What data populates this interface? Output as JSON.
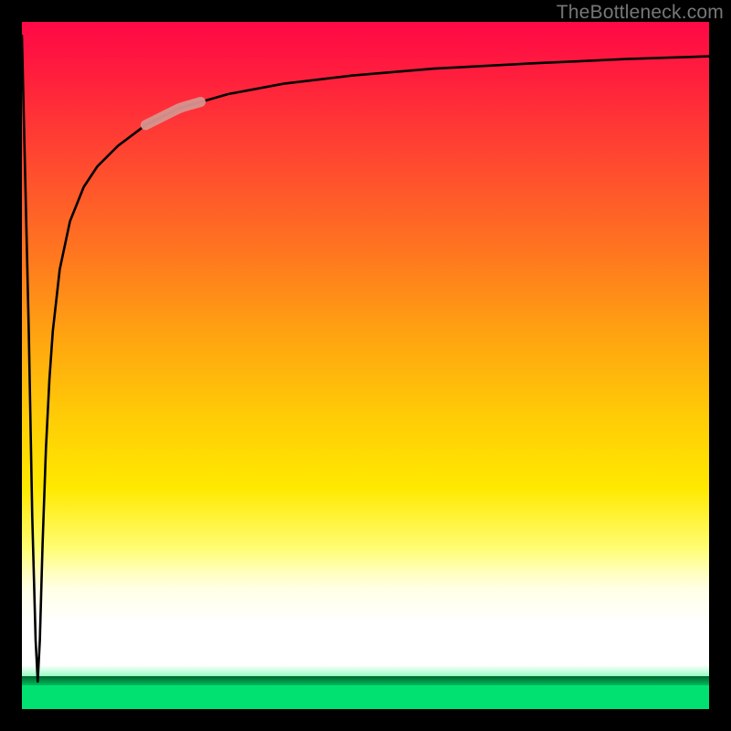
{
  "attribution": "TheBottleneck.com",
  "colors": {
    "frame": "#000000",
    "curve": "#000000",
    "highlight": "#d8948e",
    "gradient_top": "#ff0846",
    "gradient_bottom_green": "#00e172"
  },
  "chart_data": {
    "type": "line",
    "title": "",
    "xlabel": "",
    "ylabel": "",
    "xlim": [
      0,
      100
    ],
    "ylim": [
      0,
      100
    ],
    "grid": false,
    "legend": false,
    "annotations": [],
    "series": [
      {
        "name": "bottleneck-curve",
        "x": [
          0,
          1,
          1.5,
          2.0,
          2.3,
          2.6,
          3.0,
          3.5,
          4.0,
          4.5,
          5.5,
          7,
          9,
          11,
          14,
          18,
          23,
          30,
          38,
          48,
          60,
          75,
          88,
          100
        ],
        "y": [
          98,
          55,
          28,
          10,
          4,
          10,
          24,
          38,
          48,
          55,
          64,
          71,
          76,
          79,
          82,
          85,
          87.5,
          89.5,
          91,
          92.2,
          93.2,
          94,
          94.6,
          95
        ]
      }
    ],
    "highlight_segment": {
      "series": "bottleneck-curve",
      "x_start": 18,
      "x_end": 26,
      "y_start": 80,
      "y_end": 86
    },
    "background_gradient": {
      "orientation": "vertical",
      "stops": [
        {
          "pos": 0.0,
          "color": "#ff0846"
        },
        {
          "pos": 0.3,
          "color": "#ff7a1e"
        },
        {
          "pos": 0.55,
          "color": "#ffcd06"
        },
        {
          "pos": 0.78,
          "color": "#fffe7a"
        },
        {
          "pos": 0.88,
          "color": "#ffffff"
        },
        {
          "pos": 0.97,
          "color": "#7af0a8"
        },
        {
          "pos": 1.0,
          "color": "#00e172"
        }
      ]
    }
  }
}
